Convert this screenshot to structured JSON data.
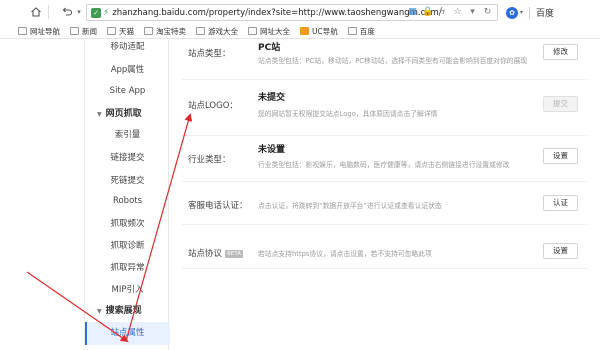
{
  "browser": {
    "url": "zhanzhang.baidu.com/property/index?site=http://www.taoshengwangm.com/",
    "search_engine": "百度",
    "bookmarks": [
      "网址导航",
      "新闻",
      "天猫",
      "淘宝特卖",
      "游戏大全",
      "网址大全",
      "UC导航",
      "百度"
    ]
  },
  "sidebar": {
    "items": [
      {
        "label": "移动适配",
        "type": "item"
      },
      {
        "label": "App属性",
        "type": "item"
      },
      {
        "label": "Site App",
        "type": "item"
      },
      {
        "label": "网页抓取",
        "type": "group"
      },
      {
        "label": "索引量",
        "type": "item"
      },
      {
        "label": "链接提交",
        "type": "item"
      },
      {
        "label": "死链提交",
        "type": "item"
      },
      {
        "label": "Robots",
        "type": "item"
      },
      {
        "label": "抓取频次",
        "type": "item"
      },
      {
        "label": "抓取诊断",
        "type": "item"
      },
      {
        "label": "抓取异常",
        "type": "item"
      },
      {
        "label": "MIP引入",
        "type": "item"
      },
      {
        "label": "搜索展现",
        "type": "group"
      },
      {
        "label": "站点属性",
        "type": "item",
        "active": true
      }
    ]
  },
  "rows": [
    {
      "label": "站点类型：",
      "value": "PC站",
      "desc": "站点类型包括：PC站，移动站，PC移动站，选择不同类型有可能会影响到百度对你的展现",
      "button": "修改",
      "button_disabled": false
    },
    {
      "label": "站点LOGO：",
      "value": "未提交",
      "desc": "您的网站暂无权限提交站点Logo，具体原因请点击了解详情",
      "button": "提交",
      "button_disabled": true
    },
    {
      "label": "行业类型：",
      "value": "未设置",
      "desc": "行业类型包括：影视娱乐，电脑数码，医疗健康等，请点击右侧链接进行设置或修改",
      "button": "设置",
      "button_disabled": false
    },
    {
      "label": "客服电话认证：",
      "value": "",
      "desc": "点击认证，将跳转到“数据开放平台”进行认证或查看认证状态",
      "button": "认证",
      "button_disabled": false
    },
    {
      "label": "站点协议",
      "tag": "BETA",
      "value": "",
      "desc": "若站点支持https协议，请点击设置，若不支持可忽略此项",
      "button": "设置",
      "button_disabled": false
    }
  ],
  "colors": {
    "accent": "#2d6ec8",
    "active_bg": "#e8f1fd",
    "annotation_arrow": "#e02a2a"
  },
  "icons": {
    "home": "home-icon",
    "undo": "undo-icon",
    "shield": "shield-icon",
    "star": "star-icon",
    "search_engine": "paw-icon"
  }
}
